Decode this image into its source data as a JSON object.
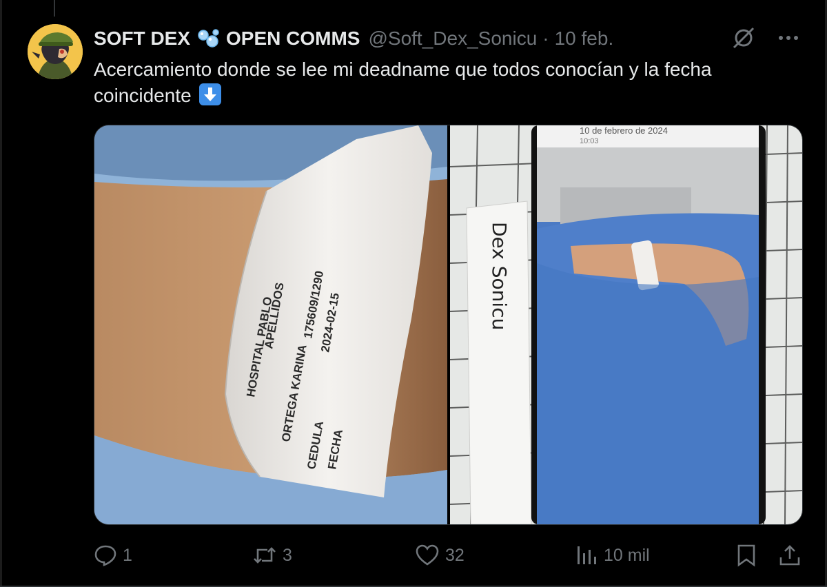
{
  "tweet": {
    "display_name": "SOFT DEX",
    "display_name_emoji": "bubbles-emoji",
    "display_name_suffix": "OPEN COMMS",
    "handle": "@Soft_Dex_Sonicu",
    "separator": "·",
    "date": "10 feb.",
    "text": "Acercamiento donde se lee mi deadname que todos conocían y la fecha coincidente",
    "text_emoji": "down-arrow-emoji",
    "images": [
      {
        "name": "wristband-closeup",
        "visible_text": [
          "HOSPITAL PABLO",
          "APELLIDOS",
          "ORTEGA KARINA",
          "175609/1290",
          "2024-02-15",
          "CEDULA",
          "FECHA"
        ]
      },
      {
        "name": "phone-photo-with-note",
        "visible_text": [
          "Dex Sonicu",
          "10 de febrero de 2024",
          "10:03"
        ]
      }
    ],
    "stats": {
      "replies": "1",
      "reposts": "3",
      "likes": "32",
      "views": "10 mil"
    }
  },
  "icons": {
    "top": [
      "grok-icon",
      "more-icon"
    ],
    "actions": [
      "reply-icon",
      "repost-icon",
      "like-icon",
      "views-icon",
      "bookmark-icon",
      "share-icon"
    ]
  },
  "colors": {
    "background": "#000000",
    "text_primary": "#e7e9ea",
    "text_secondary": "#71767b",
    "emoji_blue": "#3d8ee8",
    "avatar_yellow": "#f3c44b"
  }
}
